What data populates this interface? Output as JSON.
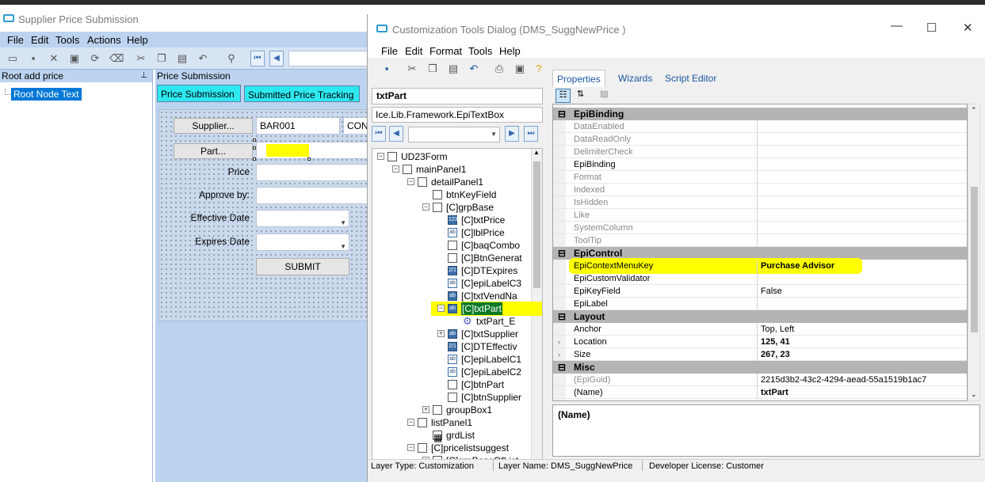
{
  "main_window": {
    "title": "Supplier Price Submission",
    "menu": [
      "File",
      "Edit",
      "Tools",
      "Actions",
      "Help"
    ],
    "tree_header": "Root add price",
    "tree_root_node": "Root Node Text",
    "panel_header": "Price Submission",
    "tabs": [
      "Price Submission",
      "Submitted Price Tracking"
    ],
    "form": {
      "supplier_button": "Supplier...",
      "supplier_value": "BAR001",
      "supplier_name_value": "CON",
      "part_button": "Part...",
      "price_label": "Price",
      "approve_label": "Approve by:",
      "effective_label": "Effective Date",
      "expires_label": "Expires Date",
      "submit_button": "SUBMIT"
    }
  },
  "dialog": {
    "title": "Customization Tools Dialog  (DMS_SuggNewPrice )",
    "menu": [
      "File",
      "Edit",
      "Format",
      "Tools",
      "Help"
    ],
    "selected_control": "txtPart",
    "control_type": "Ice.Lib.Framework.EpiTextBox",
    "tree": [
      {
        "label": "UD23Form",
        "icon": "form-icon"
      },
      {
        "label": "mainPanel1",
        "icon": "panel-icon"
      },
      {
        "label": "detailPanel1",
        "icon": "panel-icon"
      },
      {
        "label": "btnKeyField",
        "icon": "button-icon"
      },
      {
        "label": "[C]grpBase",
        "icon": "group-icon"
      },
      {
        "label": "[C]txtPrice",
        "icon": "numeric-icon"
      },
      {
        "label": "[C]lblPrice",
        "icon": "label-icon"
      },
      {
        "label": "[C]baqCombo",
        "icon": "combo-icon"
      },
      {
        "label": "[C]BtnGenerat",
        "icon": "button-icon"
      },
      {
        "label": "[C]DTExpires",
        "icon": "date-icon"
      },
      {
        "label": "[C]epiLabelC3",
        "icon": "label-icon"
      },
      {
        "label": "[C]txtVendNa",
        "icon": "textbox-icon"
      },
      {
        "label": "[C]txtPart",
        "icon": "textbox-icon"
      },
      {
        "label": "txtPart_E",
        "icon": "gear-icon"
      },
      {
        "label": "[C]txtSupplier",
        "icon": "textbox-icon"
      },
      {
        "label": "[C]DTEffectiv",
        "icon": "date-icon"
      },
      {
        "label": "[C]epiLabelC1",
        "icon": "label-icon"
      },
      {
        "label": "[C]epiLabelC2",
        "icon": "label-icon"
      },
      {
        "label": "[C]btnPart",
        "icon": "button-icon"
      },
      {
        "label": "[C]btnSupplier",
        "icon": "button-icon"
      },
      {
        "label": "groupBox1",
        "icon": "group-icon"
      },
      {
        "label": "listPanel1",
        "icon": "panel-icon"
      },
      {
        "label": "grdList",
        "icon": "grid-icon"
      },
      {
        "label": "[C]pricelistsuggest",
        "icon": "panel-icon"
      },
      {
        "label": "[C]grpBaseOfList",
        "icon": "group-icon"
      }
    ],
    "property_tabs": [
      "Properties",
      "Wizards",
      "Script Editor"
    ],
    "categories": {
      "epibinding": "EpiBinding",
      "epicontrol": "EpiControl",
      "layout": "Layout",
      "misc": "Misc"
    },
    "properties": {
      "data_enabled": "DataEnabled",
      "data_readonly": "DataReadOnly",
      "delimiter_check": "DelimiterCheck",
      "epibinding": "EpiBinding",
      "format": "Format",
      "indexed": "Indexed",
      "is_hidden": "IsHidden",
      "like": "Like",
      "system_column": "SystemColumn",
      "tooltip": "ToolTip",
      "context_menu_key": "EpiContextMenuKey",
      "context_menu_key_value": "Purchase Advisor",
      "custom_validator": "EpiCustomValidator",
      "key_field": "EpiKeyField",
      "key_field_value": "False",
      "epilabel": "EpiLabel",
      "anchor": "Anchor",
      "anchor_value": "Top, Left",
      "location": "Location",
      "location_value": "125, 41",
      "size": "Size",
      "size_value": "267, 23",
      "epiguid": "(EpiGuid)",
      "epiguid_value": "2215d3b2-43c2-4294-aead-55a1519b1ac7",
      "name": "(Name)",
      "name_value": "txtPart"
    },
    "description_title": "(Name)",
    "status": {
      "layer_type": "Layer Type:  Customization",
      "layer_name": "Layer Name:  DMS_SuggNewPrice",
      "license": "Developer License:  Customer"
    }
  },
  "colors": {
    "highlight": "#ffff00",
    "tab_active": "#2ee8f0",
    "menu_blue": "#bcd3ef"
  }
}
